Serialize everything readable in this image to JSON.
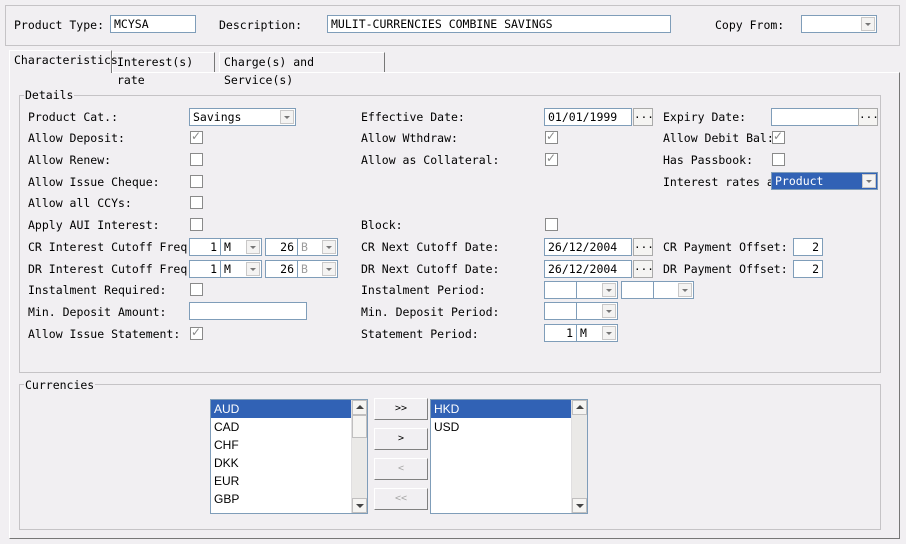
{
  "header": {
    "product_type_label": "Product Type:",
    "product_type_value": "MCYSA",
    "description_label": "Description:",
    "description_value": "MULIT-CURRENCIES COMBINE SAVINGS",
    "copy_from_label": "Copy From:",
    "copy_from_value": ""
  },
  "tabs": [
    {
      "label": "Characteristics",
      "active": true
    },
    {
      "label": "Interest(s) rate",
      "active": false
    },
    {
      "label": "Charge(s) and Service(s)",
      "active": false
    }
  ],
  "details": {
    "title": "Details",
    "product_cat_label": "Product Cat.:",
    "product_cat_value": "Savings",
    "allow_deposit_label": "Allow Deposit:",
    "allow_deposit": true,
    "allow_renew_label": "Allow Renew:",
    "allow_renew": false,
    "allow_issue_cheque_label": "Allow Issue Cheque:",
    "allow_issue_cheque": false,
    "allow_all_ccys_label": "Allow all CCYs:",
    "allow_all_ccys": false,
    "apply_aui_label": "Apply AUI Interest:",
    "apply_aui": false,
    "cr_cutoff_label": "CR Interest Cutoff Freq:",
    "cr_cutoff_num": "1",
    "cr_cutoff_unit": "M",
    "cr_cutoff_day": "26",
    "cr_cutoff_day_unit": "B",
    "dr_cutoff_label": "DR Interest Cutoff Freq:",
    "dr_cutoff_num": "1",
    "dr_cutoff_unit": "M",
    "dr_cutoff_day": "26",
    "dr_cutoff_day_unit": "B",
    "instalment_required_label": "Instalment Required:",
    "instalment_required": false,
    "min_deposit_amount_label": "Min. Deposit Amount:",
    "min_deposit_amount": "",
    "allow_issue_statement_label": "Allow Issue Statement:",
    "allow_issue_statement": true,
    "effective_date_label": "Effective Date:",
    "effective_date": "01/01/1999",
    "allow_withdraw_label": "Allow Wthdraw:",
    "allow_withdraw": true,
    "allow_collateral_label": "Allow as Collateral:",
    "allow_collateral": true,
    "block_label": "Block:",
    "block": false,
    "cr_next_cutoff_label": "CR Next Cutoff Date:",
    "cr_next_cutoff": "26/12/2004",
    "dr_next_cutoff_label": "DR Next Cutoff Date:",
    "dr_next_cutoff": "26/12/2004",
    "instalment_period_label": "Instalment Period:",
    "min_deposit_period_label": "Min. Deposit Period:",
    "statement_period_label": "Statement Period:",
    "statement_period_num": "1",
    "statement_period_unit": "M",
    "expiry_date_label": "Expiry Date:",
    "expiry_date": "",
    "allow_debit_bal_label": "Allow Debit Bal:",
    "allow_debit_bal": true,
    "has_passbook_label": "Has Passbook:",
    "has_passbook": false,
    "interest_rates_at_label": "Interest rates at:",
    "interest_rates_at": "Product",
    "cr_payment_offset_label": "CR Payment Offset:",
    "cr_payment_offset": "2",
    "dr_payment_offset_label": "DR Payment Offset:",
    "dr_payment_offset": "2",
    "ellipsis": "..."
  },
  "currencies": {
    "title": "Currencies",
    "available": [
      "AUD",
      "CAD",
      "CHF",
      "DKK",
      "EUR",
      "GBP"
    ],
    "available_selected": "AUD",
    "selected": [
      "HKD",
      "USD"
    ],
    "selected_selected": "HKD",
    "btn_add_all": ">>",
    "btn_add": ">",
    "btn_remove": "<",
    "btn_remove_all": "<<"
  },
  "colors": {
    "selection": "#3162b5",
    "window_bg": "#f1eff2"
  }
}
